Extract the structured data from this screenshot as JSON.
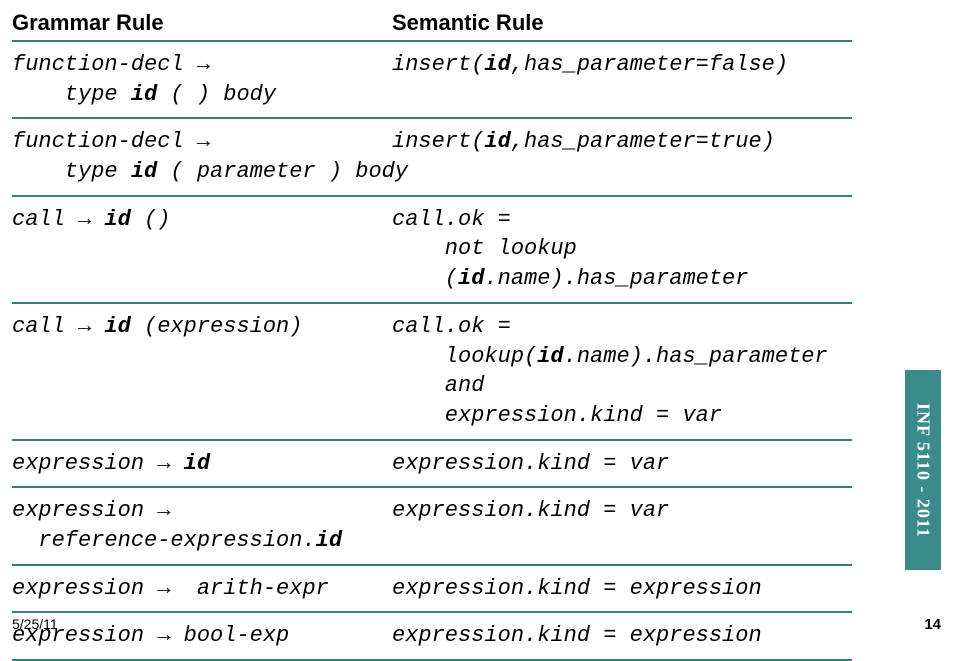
{
  "headers": {
    "left": "Grammar Rule",
    "right": "Semantic Rule"
  },
  "rows": [
    {
      "grammar": "function-decl → \n    type <b>id</b> ( ) body",
      "semantic": "insert(<b>id</b>,has_parameter=false)"
    },
    {
      "grammar": "function-decl → \n    type <b>id</b> ( parameter ) body",
      "semantic": "insert(<b>id</b>,has_parameter=true)"
    },
    {
      "grammar": "call → <b>id</b> ()",
      "semantic": "call.ok =\n    not lookup\n    (<b>id</b>.name).has_parameter"
    },
    {
      "grammar": "call → <b>id</b> (expression)",
      "semantic": "call.ok =\n    lookup(<b>id</b>.name).has_parameter\n    and\n    expression.kind = var"
    },
    {
      "grammar": "expression → <b>id</b>",
      "semantic": "expression.kind = var"
    },
    {
      "grammar": "expression →\n  reference-expression.<b>id</b>",
      "semantic": "expression.kind = var"
    },
    {
      "grammar": "expression →  arith-expr",
      "semantic": "expression.kind = expression"
    },
    {
      "grammar": "expression → bool-exp",
      "semantic": "expression.kind = expression"
    }
  ],
  "sideLabel": "INF 5110 - 2011",
  "footer": {
    "date": "5/25/11",
    "page": "14"
  }
}
